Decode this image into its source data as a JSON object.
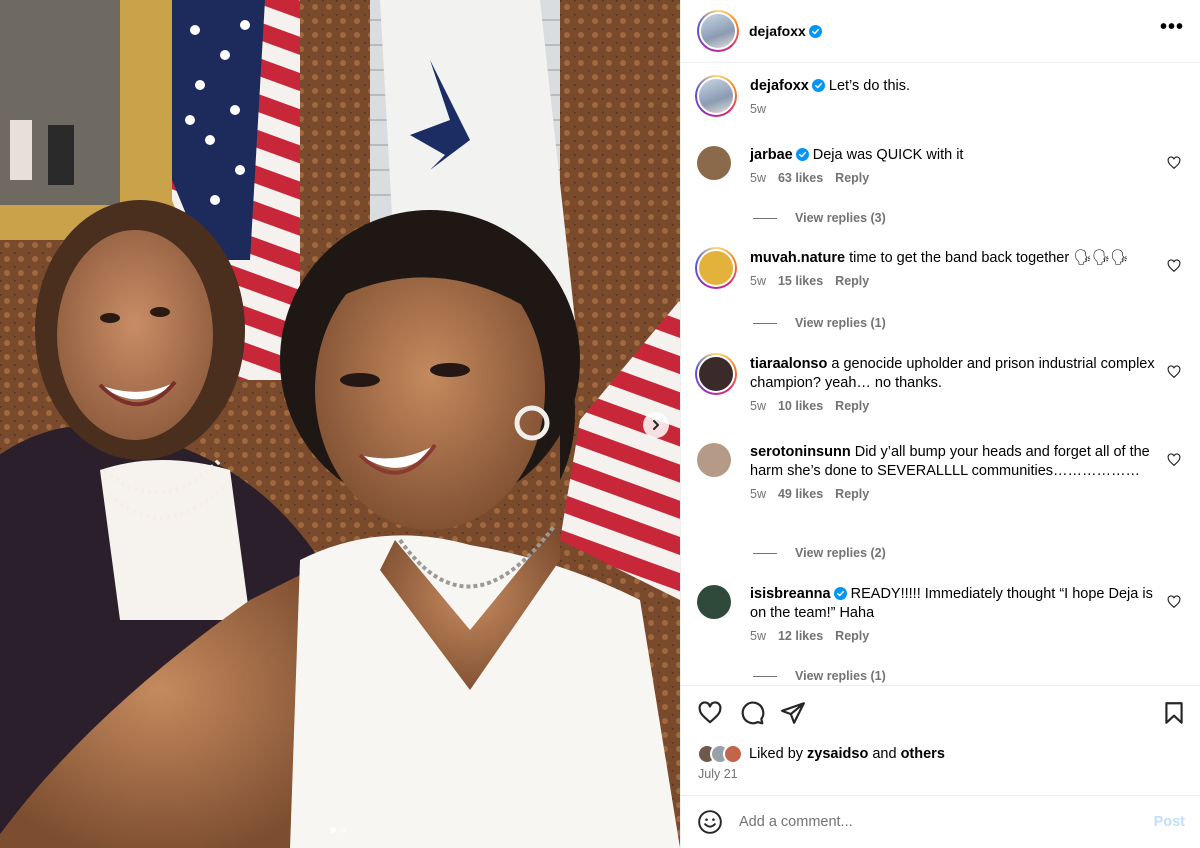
{
  "header": {
    "username": "dejafoxx",
    "more_label": "•••"
  },
  "caption": {
    "username": "dejafoxx",
    "text": "Let’s do this.",
    "time": "5w"
  },
  "comments": [
    {
      "username": "jarbae",
      "verified": true,
      "text": "Deja was QUICK with it",
      "time": "5w",
      "likes": "63 likes",
      "reply": "Reply",
      "view_replies": "View replies (3)",
      "avatar_color": "#8a6a4a"
    },
    {
      "username": "muvah.nature",
      "verified": false,
      "text": "time to get the band back together 🗣🗣🗣",
      "time": "5w",
      "likes": "15 likes",
      "reply": "Reply",
      "view_replies": "View replies (1)",
      "avatar_color": "#e2b23a"
    },
    {
      "username": "tiaraalonso",
      "verified": false,
      "text": "a genocide upholder and prison industrial complex champion? yeah… no thanks.",
      "time": "5w",
      "likes": "10 likes",
      "reply": "Reply",
      "view_replies": "",
      "avatar_color": "#3a2a2a"
    },
    {
      "username": "serotoninsunn",
      "verified": false,
      "text": "Did y’all bump your heads and forget all of the harm she’s done to SEVERALLLL communities………………",
      "time": "5w",
      "likes": "49 likes",
      "reply": "Reply",
      "view_replies": "View replies (2)",
      "avatar_color": "#b59a88"
    },
    {
      "username": "isisbreanna",
      "verified": true,
      "text": "READY!!!!! Immediately thought “I hope Deja is on the team!” Haha",
      "time": "5w",
      "likes": "12 likes",
      "reply": "Reply",
      "view_replies": "View replies (1)",
      "avatar_color": "#2f4a3a"
    }
  ],
  "likes_line": {
    "prefix": "Liked by",
    "user": "zysaidso",
    "and": "and",
    "others": "others"
  },
  "date": "July 21",
  "add_comment": {
    "placeholder": "Add a comment...",
    "post_label": "Post"
  },
  "colors": {
    "verified_blue": "#0095f6",
    "muted_text": "#737373",
    "post_disabled": "#c0dffd"
  },
  "carousel": {
    "current_index": 1,
    "total": 2
  }
}
